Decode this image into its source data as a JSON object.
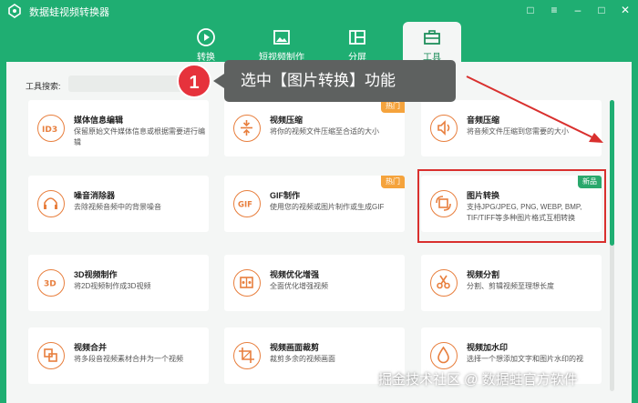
{
  "app": {
    "title": "数据蛙视频转换器"
  },
  "tabs": [
    {
      "label": "转换",
      "icon": "convert-icon"
    },
    {
      "label": "短视频制作",
      "icon": "video-maker-icon"
    },
    {
      "label": "分屏",
      "icon": "split-screen-icon"
    },
    {
      "label": "工具",
      "icon": "toolbox-icon",
      "active": true
    }
  ],
  "search": {
    "label": "工具搜索:",
    "placeholder": ""
  },
  "callout": {
    "step": "1",
    "text": "选中【图片转换】功能"
  },
  "cards": [
    {
      "title": "媒体信息编辑",
      "desc": "保留原始文件媒体信息或根据需要进行编辑",
      "icon": "id3-icon",
      "badge": ""
    },
    {
      "title": "视频压缩",
      "desc": "将你的视频文件压缩至合适的大小",
      "icon": "compress-icon",
      "badge": "热门"
    },
    {
      "title": "音频压缩",
      "desc": "将音频文件压缩到您需要的大小",
      "icon": "audio-compress-icon",
      "badge": ""
    },
    {
      "title": "噪音消除器",
      "desc": "去除视频音频中的背景噪音",
      "icon": "noise-icon",
      "badge": ""
    },
    {
      "title": "GIF制作",
      "desc": "使用您的视频或图片制作或生成GIF",
      "icon": "gif-icon",
      "badge": "热门"
    },
    {
      "title": "图片转换",
      "desc": "支持JPG/JPEG, PNG, WEBP, BMP, TIF/TIFF等多种图片格式互相转换",
      "icon": "image-convert-icon",
      "badge": "新品"
    },
    {
      "title": "3D视频制作",
      "desc": "将2D视频制作成3D视频",
      "icon": "3d-icon",
      "badge": ""
    },
    {
      "title": "视频优化增强",
      "desc": "全面优化增强视频",
      "icon": "enhance-icon",
      "badge": ""
    },
    {
      "title": "视频分割",
      "desc": "分割、剪辑视频至理想长度",
      "icon": "scissors-icon",
      "badge": ""
    },
    {
      "title": "视频合并",
      "desc": "将多段音视频素材合并为一个视频",
      "icon": "merge-icon",
      "badge": ""
    },
    {
      "title": "视频画面裁剪",
      "desc": "裁剪多余的视频画面",
      "icon": "crop-icon",
      "badge": ""
    },
    {
      "title": "视频加水印",
      "desc": "选择一个想添加文字和图片水印的视",
      "icon": "watermark-icon",
      "badge": ""
    }
  ],
  "watermark": "掘金技术社区 @ 数据蛙官方软件",
  "colors": {
    "brand": "#1fae72",
    "accent": "#e87f3e",
    "hot": "#f5a33c",
    "new": "#2aa86c",
    "highlight": "#d9302e"
  }
}
